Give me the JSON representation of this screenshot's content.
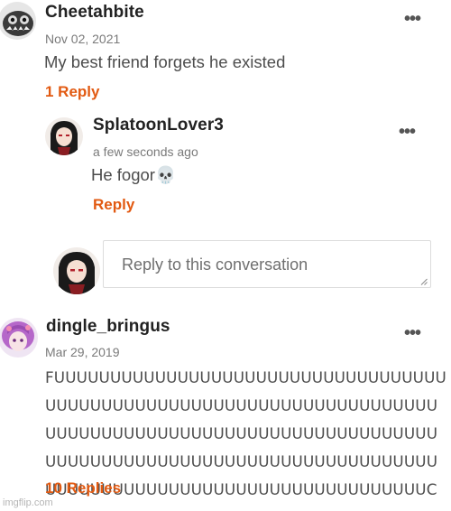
{
  "comments": [
    {
      "username": "Cheetahbite",
      "timestamp": "Nov 02, 2021",
      "text": "My best friend forgets he existed",
      "replies_link": "1 Reply",
      "reply": {
        "username": "SplatoonLover3",
        "timestamp": "a few seconds ago",
        "text": "He fogor💀",
        "reply_link": "Reply"
      },
      "reply_box": {
        "placeholder": "Reply to this conversation"
      }
    },
    {
      "username": "dingle_bringus",
      "timestamp": "Mar 29, 2019",
      "text": "FUUUUUUUUUUUUUUUUUUUUUUUUUUUUUUUUUUUUUUUUUUUUUUUUUUUUUUUUUUUUUUUUUUUUUUUUUUUUUUUUUUUUUUUUUUUUUUUUUUUUUUUUUUUUUUUUUUUUUUUUUUUUUUUUUUUUUUUUUUUUUUUUUUUUUUUUUUUUUUUUUUUUUUUUUUUUUUCK",
      "replies_link": "10 Replies"
    }
  ],
  "more_options_glyph": "•••",
  "watermark": "imgflip.com"
}
